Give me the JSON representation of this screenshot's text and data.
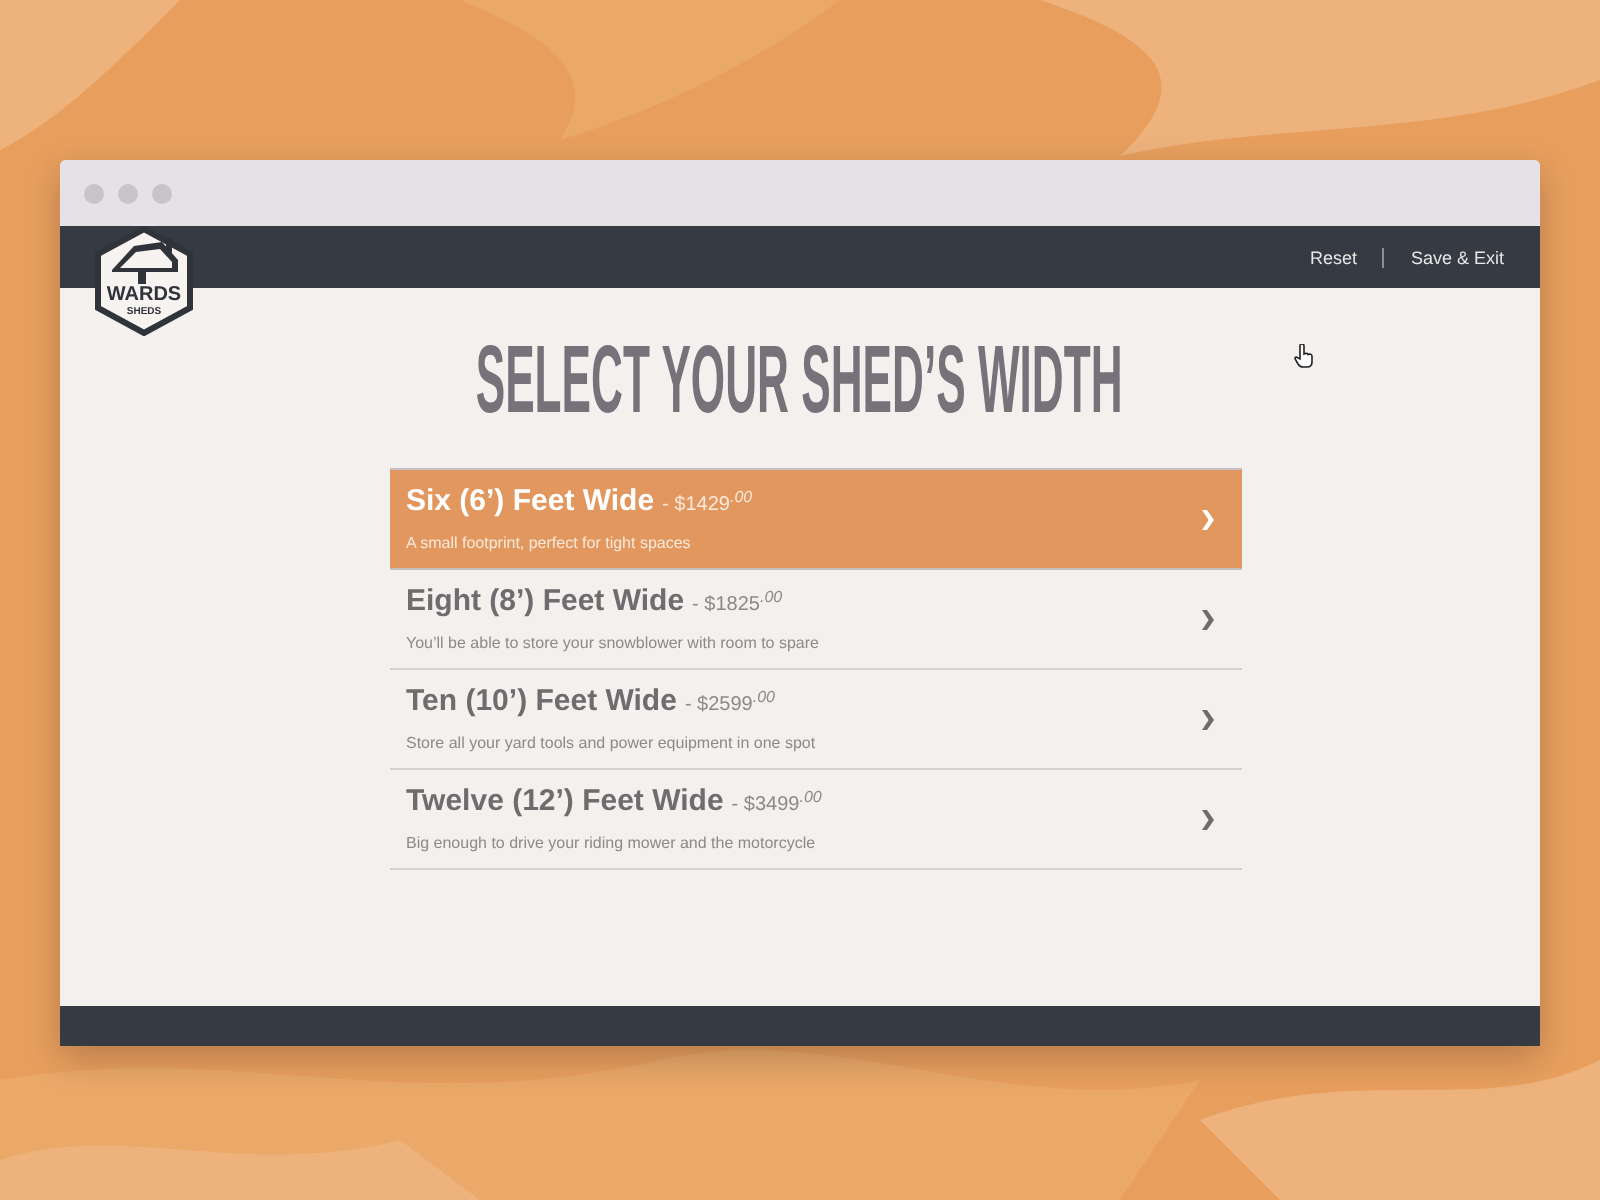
{
  "logo": {
    "name": "WARDS",
    "subtitle": "SHEDS"
  },
  "nav": {
    "links": [
      "Reset",
      "Save & Exit"
    ]
  },
  "page": {
    "title": "SELECT YOUR SHED’S WIDTH"
  },
  "options": [
    {
      "name": "Six (6’) Feet Wide",
      "price": "- $1429$^{.00}$",
      "description": "A small footprint, perfect for tight spaces",
      "selected": true
    },
    {
      "name": "Eight (8’) Feet Wide",
      "price": "- $1825$^{.00}$",
      "description": "You’ll be able to store your snowblower with room to spare",
      "selected": false
    },
    {
      "name": "Ten (10’) Feet Wide",
      "price": "- $2599$^{.00}$",
      "description": "Store all your yard tools and power equipment in one spot",
      "selected": false
    },
    {
      "name": "Twelve (12’) Feet Wide",
      "price": "- $3499$^{.00}$",
      "description": "Big enough to drive your riding mower and the motorcycle",
      "selected": false
    }
  ]
}
